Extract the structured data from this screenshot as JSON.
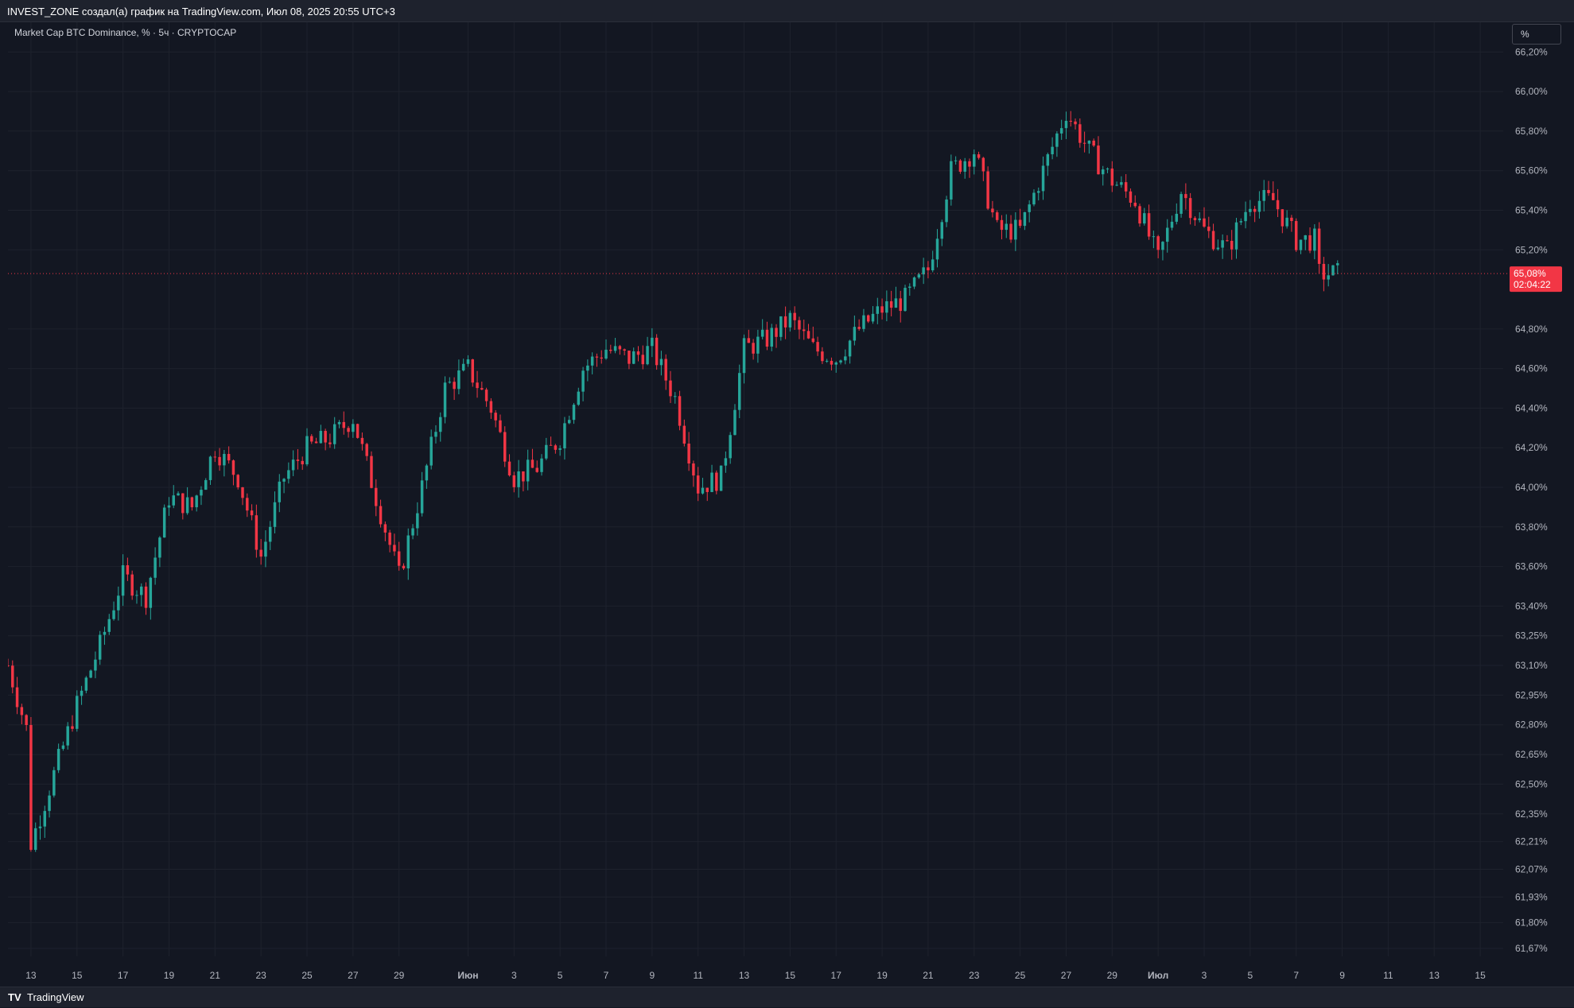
{
  "header": {
    "attribution": "INVEST_ZONE создал(а) график на TradingView.com, Июл 08, 2025 20:55 UTC+3"
  },
  "legend": {
    "title": "Market Cap BTC Dominance, % · 5ч · CRYPTOCAP"
  },
  "scale_button": {
    "label": "%"
  },
  "footer": {
    "logo_glyph": "TV",
    "brand": "TradingView"
  },
  "colors": {
    "background": "#131722",
    "up": "#26a69a",
    "down": "#f23645",
    "grid": "#1e222d"
  },
  "chart_data": {
    "type": "candlestick",
    "timeframe": "5ч",
    "symbol": "CRYPTOCAP",
    "series_name": "Market Cap BTC Dominance, %",
    "unit": "%",
    "y_scale": "percent",
    "ylim": [
      61.63,
      66.35
    ],
    "y_ticks": [
      {
        "value": 66.2,
        "label": "66,20%"
      },
      {
        "value": 66.0,
        "label": "66,00%"
      },
      {
        "value": 65.8,
        "label": "65,80%"
      },
      {
        "value": 65.6,
        "label": "65,60%"
      },
      {
        "value": 65.4,
        "label": "65,40%"
      },
      {
        "value": 65.2,
        "label": "65,20%"
      },
      {
        "value": 64.8,
        "label": "64,80%"
      },
      {
        "value": 64.6,
        "label": "64,60%"
      },
      {
        "value": 64.4,
        "label": "64,40%"
      },
      {
        "value": 64.2,
        "label": "64,20%"
      },
      {
        "value": 64.0,
        "label": "64,00%"
      },
      {
        "value": 63.8,
        "label": "63,80%"
      },
      {
        "value": 63.6,
        "label": "63,60%"
      },
      {
        "value": 63.4,
        "label": "63,40%"
      },
      {
        "value": 63.25,
        "label": "63,25%"
      },
      {
        "value": 63.1,
        "label": "63,10%"
      },
      {
        "value": 62.95,
        "label": "62,95%"
      },
      {
        "value": 62.8,
        "label": "62,80%"
      },
      {
        "value": 62.65,
        "label": "62,65%"
      },
      {
        "value": 62.5,
        "label": "62,50%"
      },
      {
        "value": 62.35,
        "label": "62,35%"
      },
      {
        "value": 62.21,
        "label": "62,21%"
      },
      {
        "value": 62.07,
        "label": "62,07%"
      },
      {
        "value": 61.93,
        "label": "61,93%"
      },
      {
        "value": 61.8,
        "label": "61,80%"
      },
      {
        "value": 61.67,
        "label": "61,67%"
      }
    ],
    "x_ticks": [
      {
        "day": "2025-05-13",
        "label": "13"
      },
      {
        "day": "2025-05-15",
        "label": "15"
      },
      {
        "day": "2025-05-17",
        "label": "17"
      },
      {
        "day": "2025-05-19",
        "label": "19"
      },
      {
        "day": "2025-05-21",
        "label": "21"
      },
      {
        "day": "2025-05-23",
        "label": "23"
      },
      {
        "day": "2025-05-25",
        "label": "25"
      },
      {
        "day": "2025-05-27",
        "label": "27"
      },
      {
        "day": "2025-05-29",
        "label": "29"
      },
      {
        "day": "2025-06-01",
        "label": "Июн",
        "bold": true
      },
      {
        "day": "2025-06-03",
        "label": "3"
      },
      {
        "day": "2025-06-05",
        "label": "5"
      },
      {
        "day": "2025-06-07",
        "label": "7"
      },
      {
        "day": "2025-06-09",
        "label": "9"
      },
      {
        "day": "2025-06-11",
        "label": "11"
      },
      {
        "day": "2025-06-13",
        "label": "13"
      },
      {
        "day": "2025-06-15",
        "label": "15"
      },
      {
        "day": "2025-06-17",
        "label": "17"
      },
      {
        "day": "2025-06-19",
        "label": "19"
      },
      {
        "day": "2025-06-21",
        "label": "21"
      },
      {
        "day": "2025-06-23",
        "label": "23"
      },
      {
        "day": "2025-06-25",
        "label": "25"
      },
      {
        "day": "2025-06-27",
        "label": "27"
      },
      {
        "day": "2025-06-29",
        "label": "29"
      },
      {
        "day": "2025-07-01",
        "label": "Июл",
        "bold": true
      },
      {
        "day": "2025-07-03",
        "label": "3"
      },
      {
        "day": "2025-07-05",
        "label": "5"
      },
      {
        "day": "2025-07-07",
        "label": "7"
      },
      {
        "day": "2025-07-09",
        "label": "9"
      },
      {
        "day": "2025-07-11",
        "label": "11"
      },
      {
        "day": "2025-07-13",
        "label": "13"
      },
      {
        "day": "2025-07-15",
        "label": "15"
      }
    ],
    "x_range": [
      "2025-05-12",
      "2025-07-16"
    ],
    "path_points": [
      {
        "day": "2025-05-12",
        "v": 63.1
      },
      {
        "day": "2025-05-13",
        "v": 62.7
      },
      {
        "day": "2025-05-13",
        "v": 62.2
      },
      {
        "day": "2025-05-14",
        "v": 62.55
      },
      {
        "day": "2025-05-15",
        "v": 62.9
      },
      {
        "day": "2025-05-16",
        "v": 63.2
      },
      {
        "day": "2025-05-17",
        "v": 63.55
      },
      {
        "day": "2025-05-18",
        "v": 63.45
      },
      {
        "day": "2025-05-19",
        "v": 63.95
      },
      {
        "day": "2025-05-20",
        "v": 63.9
      },
      {
        "day": "2025-05-21",
        "v": 64.2
      },
      {
        "day": "2025-05-22",
        "v": 64.05
      },
      {
        "day": "2025-05-23",
        "v": 63.65
      },
      {
        "day": "2025-05-24",
        "v": 64.05
      },
      {
        "day": "2025-05-25",
        "v": 64.2
      },
      {
        "day": "2025-05-26",
        "v": 64.25
      },
      {
        "day": "2025-05-27",
        "v": 64.35
      },
      {
        "day": "2025-05-28",
        "v": 63.95
      },
      {
        "day": "2025-05-29",
        "v": 63.55
      },
      {
        "day": "2025-05-30",
        "v": 64.0
      },
      {
        "day": "2025-05-31",
        "v": 64.5
      },
      {
        "day": "2025-06-01",
        "v": 64.6
      },
      {
        "day": "2025-06-02",
        "v": 64.4
      },
      {
        "day": "2025-06-03",
        "v": 64.05
      },
      {
        "day": "2025-06-04",
        "v": 64.1
      },
      {
        "day": "2025-06-05",
        "v": 64.25
      },
      {
        "day": "2025-06-06",
        "v": 64.6
      },
      {
        "day": "2025-06-07",
        "v": 64.7
      },
      {
        "day": "2025-06-08",
        "v": 64.65
      },
      {
        "day": "2025-06-09",
        "v": 64.7
      },
      {
        "day": "2025-06-10",
        "v": 64.45
      },
      {
        "day": "2025-06-11",
        "v": 64.0
      },
      {
        "day": "2025-06-12",
        "v": 64.05
      },
      {
        "day": "2025-06-13",
        "v": 64.7
      },
      {
        "day": "2025-06-14",
        "v": 64.75
      },
      {
        "day": "2025-06-15",
        "v": 64.85
      },
      {
        "day": "2025-06-16",
        "v": 64.7
      },
      {
        "day": "2025-06-17",
        "v": 64.65
      },
      {
        "day": "2025-06-18",
        "v": 64.8
      },
      {
        "day": "2025-06-19",
        "v": 64.9
      },
      {
        "day": "2025-06-20",
        "v": 64.95
      },
      {
        "day": "2025-06-21",
        "v": 65.1
      },
      {
        "day": "2025-06-22",
        "v": 65.6
      },
      {
        "day": "2025-06-23",
        "v": 65.7
      },
      {
        "day": "2025-06-24",
        "v": 65.3
      },
      {
        "day": "2025-06-25",
        "v": 65.3
      },
      {
        "day": "2025-06-26",
        "v": 65.6
      },
      {
        "day": "2025-06-27",
        "v": 65.9
      },
      {
        "day": "2025-06-28",
        "v": 65.7
      },
      {
        "day": "2025-06-29",
        "v": 65.55
      },
      {
        "day": "2025-06-30",
        "v": 65.45
      },
      {
        "day": "2025-07-01",
        "v": 65.15
      },
      {
        "day": "2025-07-02",
        "v": 65.5
      },
      {
        "day": "2025-07-03",
        "v": 65.3
      },
      {
        "day": "2025-07-04",
        "v": 65.2
      },
      {
        "day": "2025-07-05",
        "v": 65.45
      },
      {
        "day": "2025-07-06",
        "v": 65.45
      },
      {
        "day": "2025-07-07",
        "v": 65.25
      },
      {
        "day": "2025-07-08",
        "v": 65.25
      },
      {
        "day": "2025-07-08",
        "v": 65.08
      }
    ],
    "candles_per_day": 5,
    "current_price": {
      "value": 65.08,
      "label": "65,08%",
      "countdown": "02:04:22"
    },
    "grid": true
  }
}
